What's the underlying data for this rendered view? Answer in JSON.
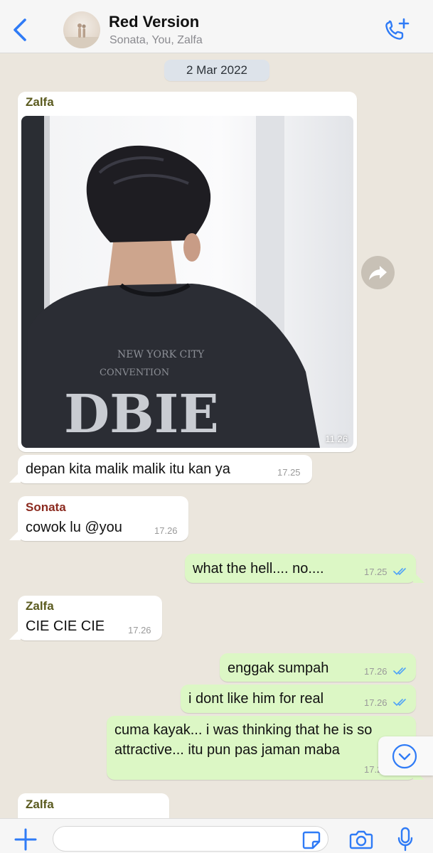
{
  "header": {
    "title": "Red Version",
    "members": "Sonata, You, Zalfa"
  },
  "date_chip": "2 Mar 2022",
  "colors": {
    "accent": "#2f7bf6",
    "incoming_bubble": "#ffffff",
    "outgoing_bubble": "#dcf7c5",
    "read_ticks": "#4fa3f7",
    "sender_zalfa": "#5a5a1e",
    "sender_sonata": "#8b2a1f",
    "chat_background": "#ebe6dd"
  },
  "icons": {
    "back": "chevron-left-icon",
    "call": "phone-plus-icon",
    "forward": "forward-arrow-icon",
    "scroll_down": "chevron-down-circle-icon",
    "attach": "plus-icon",
    "sticker": "sticker-icon",
    "camera": "camera-icon",
    "mic": "microphone-icon"
  },
  "messages": [
    {
      "direction": "in",
      "sender": "Zalfa",
      "type": "image",
      "time": "11.26"
    },
    {
      "direction": "in",
      "text": "depan kita malik malik itu kan ya",
      "time": "17.25"
    },
    {
      "direction": "in",
      "sender": "Sonata",
      "text": "cowok lu @you",
      "time": "17.26"
    },
    {
      "direction": "out",
      "text": "what the hell.... no....",
      "time": "17.25",
      "read": true
    },
    {
      "direction": "in",
      "sender": "Zalfa",
      "text": "CIE CIE CIE",
      "time": "17.26"
    },
    {
      "direction": "out",
      "text": "enggak sumpah",
      "time": "17.26",
      "read": true
    },
    {
      "direction": "out",
      "text": "i dont like him for real",
      "time": "17.26",
      "read": true
    },
    {
      "direction": "out",
      "text": "cuma kayak... i was thinking that he is so attractive... itu pun pas jaman maba",
      "time": "17.26",
      "read": true
    },
    {
      "direction": "in",
      "sender": "Zalfa",
      "text": ""
    }
  ],
  "composer": {
    "value": ""
  }
}
